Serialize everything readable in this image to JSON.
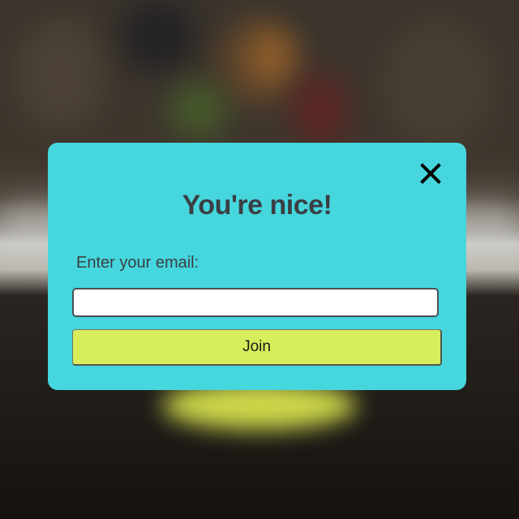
{
  "modal": {
    "title": "You're nice!",
    "email_label": "Enter your email:",
    "email_value": "",
    "email_placeholder": "",
    "join_label": "Join",
    "close_icon": "close-icon",
    "colors": {
      "modal_background": "#46d6dd",
      "button_background": "#d8ed5b",
      "text": "#3a3f44"
    }
  }
}
